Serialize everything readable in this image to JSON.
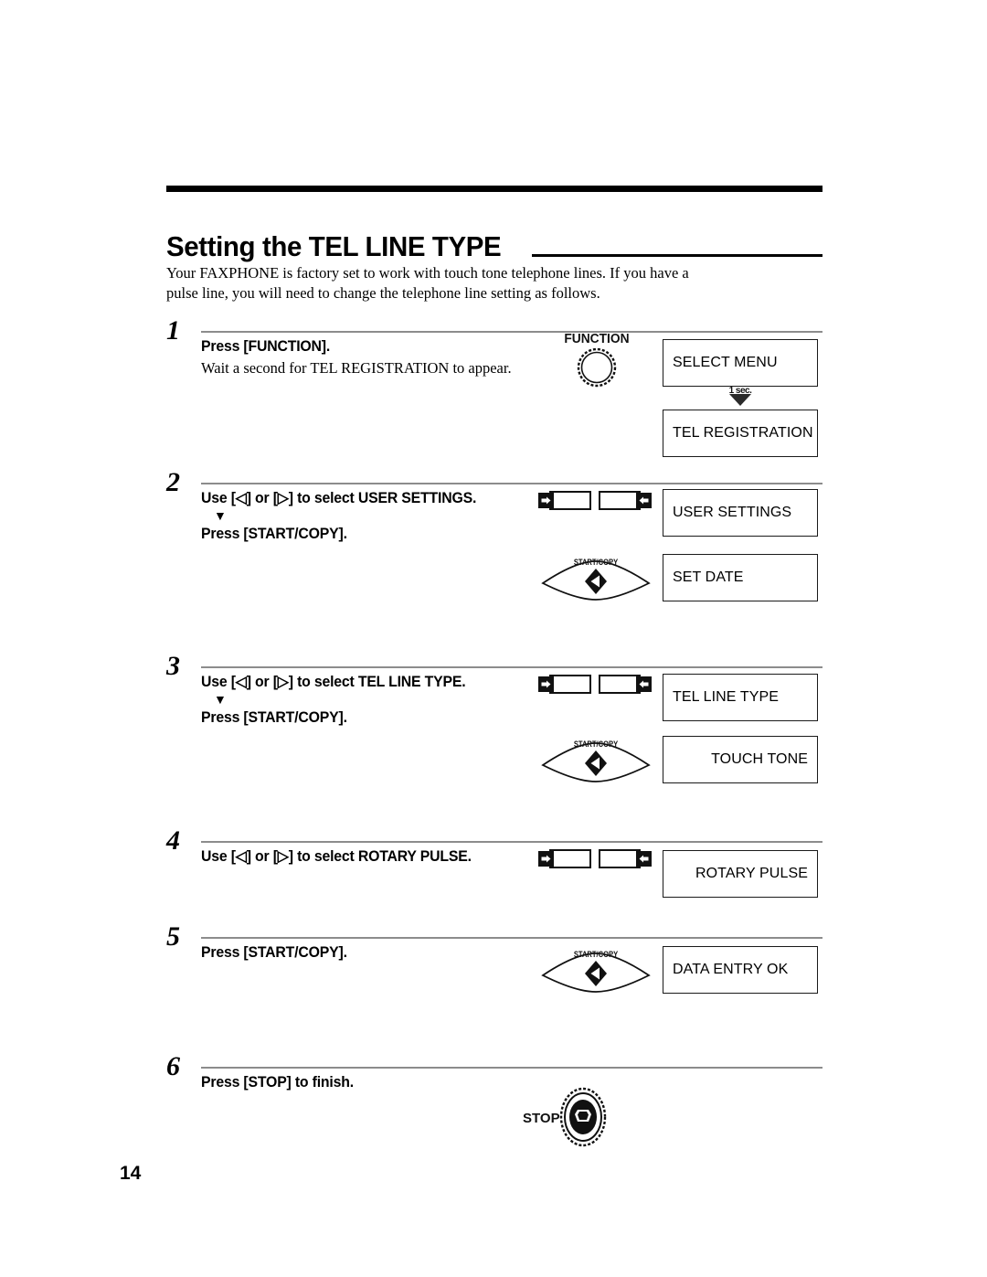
{
  "page": {
    "number": "14",
    "title": "Setting the TEL LINE TYPE",
    "intro": "Your FAXPHONE is factory set to work with touch tone telephone lines. If you have a pulse line, you will need to change the telephone line setting as follows."
  },
  "symbols": {
    "left_key": "[◁]",
    "right_key": "[▷]",
    "down_triangle": "▼",
    "one_sec_label": "1 sec."
  },
  "buttons": {
    "function_label": "FUNCTION",
    "start_copy_label": "START/COPY",
    "stop_label": "STOP"
  },
  "steps": [
    {
      "number": "1",
      "main": "Press [FUNCTION].",
      "sub": "Wait a second for TEL REGISTRATION to appear.",
      "main2": "",
      "displays": [
        {
          "text": "SELECT MENU",
          "align": "left"
        },
        {
          "text": "TEL REGISTRATION",
          "align": "left"
        }
      ],
      "icon": "function-button"
    },
    {
      "number": "2",
      "main": "Use [◁] or [▷] to select USER SETTINGS.",
      "sub": "",
      "main2": "Press [START/COPY].",
      "displays": [
        {
          "text": "USER SETTINGS",
          "align": "left"
        },
        {
          "text": "SET DATE",
          "align": "left"
        }
      ],
      "icon": "arrow-keys-and-start-copy"
    },
    {
      "number": "3",
      "main": "Use [◁] or [▷] to select TEL LINE TYPE.",
      "sub": "",
      "main2": "Press [START/COPY].",
      "displays": [
        {
          "text": "TEL LINE TYPE",
          "align": "left"
        },
        {
          "text": "TOUCH TONE",
          "align": "right"
        }
      ],
      "icon": "arrow-keys-and-start-copy"
    },
    {
      "number": "4",
      "main": "Use [◁] or [▷] to select ROTARY PULSE.",
      "sub": "",
      "main2": "",
      "displays": [
        {
          "text": "ROTARY PULSE",
          "align": "right"
        }
      ],
      "icon": "arrow-keys"
    },
    {
      "number": "5",
      "main": "Press [START/COPY].",
      "sub": "",
      "main2": "",
      "displays": [
        {
          "text": "DATA ENTRY OK",
          "align": "left"
        }
      ],
      "icon": "start-copy"
    },
    {
      "number": "6",
      "main": "Press [STOP] to finish.",
      "sub": "",
      "main2": "",
      "displays": [],
      "icon": "stop-button"
    }
  ]
}
